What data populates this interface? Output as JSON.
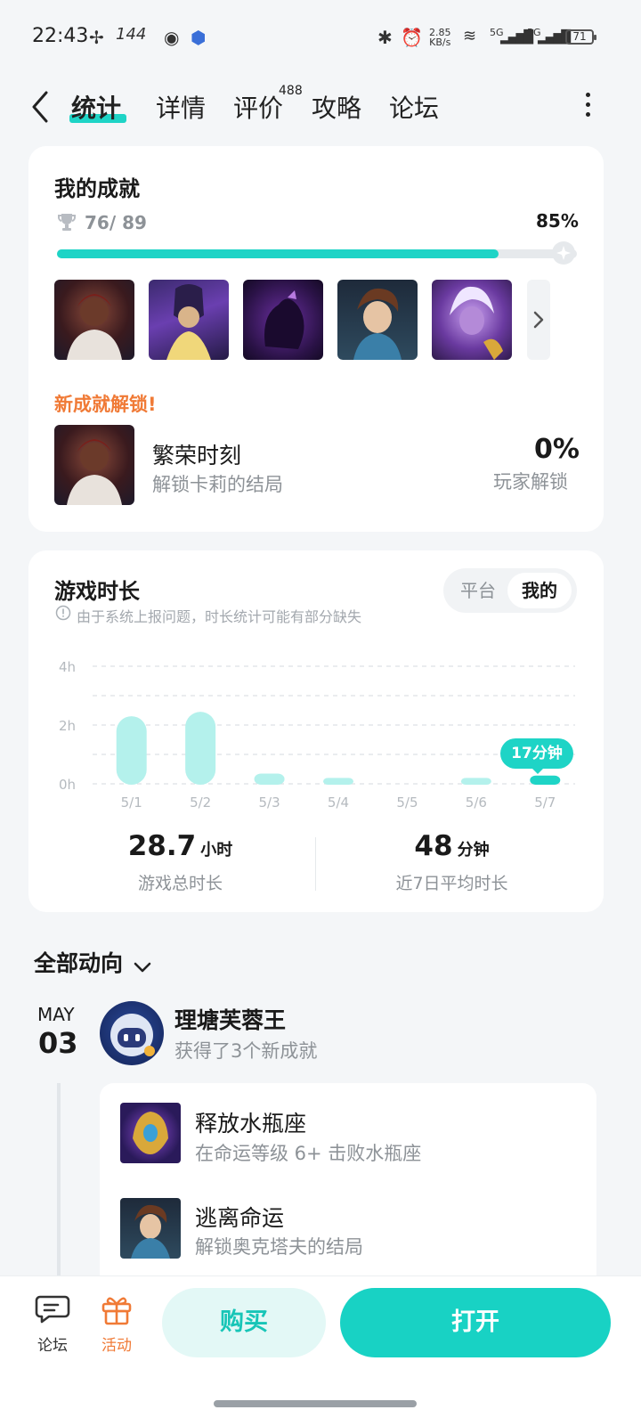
{
  "status": {
    "time": "22:43",
    "refresh": "144",
    "net_speed": "2.85",
    "net_unit": "KB/s",
    "sim1": "5G",
    "sim2": "5G",
    "battery": "71"
  },
  "nav": {
    "tabs": [
      "统计",
      "详情",
      "评价",
      "攻略",
      "论坛"
    ],
    "active_tab": "统计",
    "review_count": "488"
  },
  "achievements": {
    "title": "我的成就",
    "earned": "76/ 89",
    "percent_label": "85%",
    "progress": 0.85,
    "new_unlock_label": "新成就解锁!",
    "unlock": {
      "name": "繁荣时刻",
      "desc": "解锁卡莉的结局",
      "rate": "0%",
      "rate_label": "玩家解锁"
    }
  },
  "playtime": {
    "title": "游戏时长",
    "notice": "由于系统上报问题，时长统计可能有部分缺失",
    "toggle": {
      "platform": "平台",
      "mine": "我的",
      "selected": "我的"
    },
    "tooltip": "17分钟",
    "total_value": "28.7",
    "total_unit": "小时",
    "total_label": "游戏总时长",
    "avg_value": "48",
    "avg_unit": "分钟",
    "avg_label": "近7日平均时长"
  },
  "chart_data": {
    "type": "bar",
    "categories": [
      "5/1",
      "5/2",
      "5/3",
      "5/4",
      "5/5",
      "5/6",
      "5/7"
    ],
    "values": [
      2.3,
      2.45,
      0.35,
      0.2,
      0,
      0.2,
      0.28
    ],
    "ylabel": "",
    "ylim": [
      0,
      4
    ],
    "yticks": [
      "0h",
      "2h",
      "4h"
    ],
    "grid": true,
    "bar_color": "#b4f1ec",
    "highlight_color": "#1ed4c6",
    "highlight_index": 6
  },
  "feed": {
    "filter_label": "全部动向",
    "month": "MAY",
    "day": "03",
    "user": "理塘芙蓉王",
    "action": "获得了3个新成就",
    "items": [
      {
        "name": "释放水瓶座",
        "desc": "在命运等级 6+ 击败水瓶座"
      },
      {
        "name": "逃离命运",
        "desc": "解锁奥克塔夫的结局"
      }
    ]
  },
  "bottom": {
    "forum_label": "论坛",
    "activity_label": "活动",
    "buy_label": "购买",
    "open_label": "打开"
  },
  "colors": {
    "accent": "#1ed4c6",
    "accent_light": "#b4f1ec",
    "orange": "#f07a36"
  }
}
